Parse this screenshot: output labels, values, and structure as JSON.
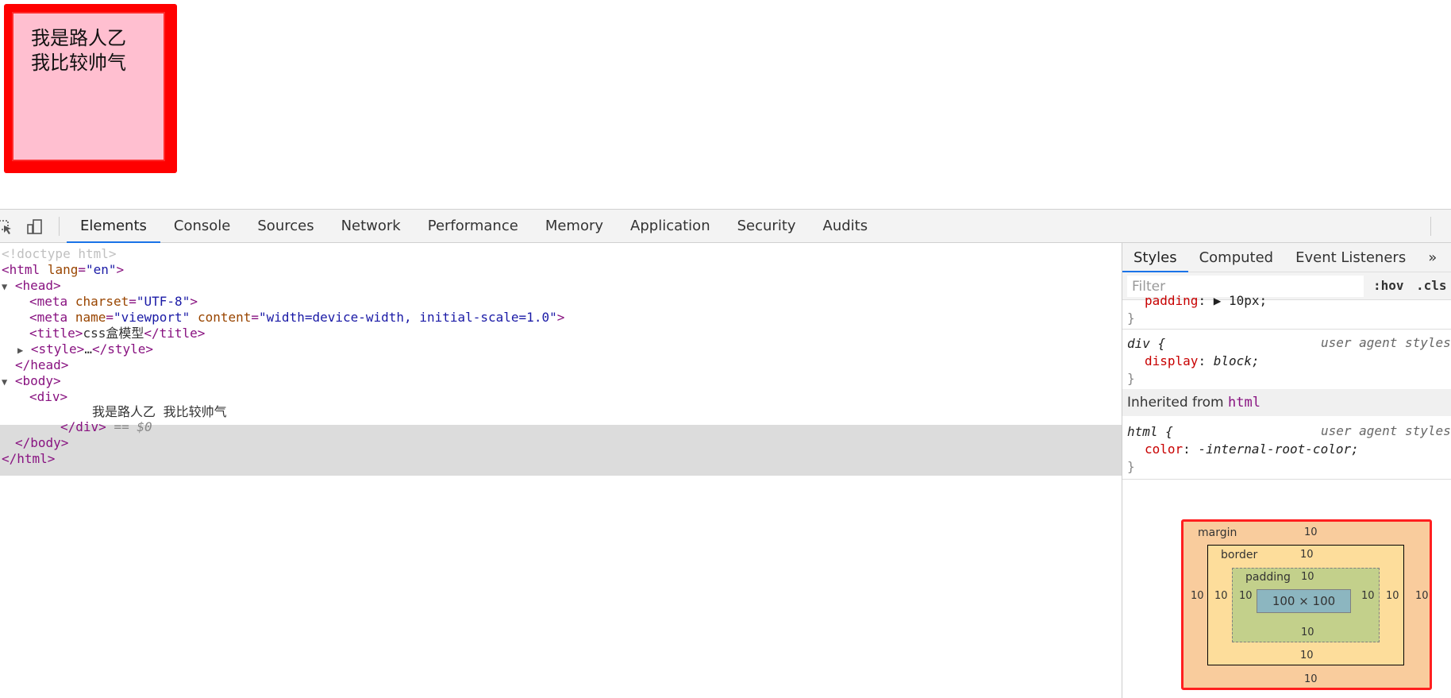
{
  "preview": {
    "line1": "我是路人乙",
    "line2": "我比较帅气"
  },
  "toolbar": {
    "inspect_icon": "inspect-arrow-icon",
    "device_icon": "device-toolbar-icon",
    "tabs": [
      "Elements",
      "Console",
      "Sources",
      "Network",
      "Performance",
      "Memory",
      "Application",
      "Security",
      "Audits"
    ],
    "active_tab": "Elements"
  },
  "dom": {
    "doctype": "<!doctype html>",
    "html_open_tag": "<html",
    "html_attr": "lang",
    "html_attr_val": "\"en\"",
    "head_open": "<head>",
    "meta1_tag": "<meta",
    "meta1_attr": "charset",
    "meta1_val": "\"UTF-8\"",
    "meta2_tag": "<meta",
    "meta2_attr1": "name",
    "meta2_val1": "\"viewport\"",
    "meta2_attr2": "content",
    "meta2_val2": "\"width=device-width, initial-scale=1.0\"",
    "title_open": "<title>",
    "title_text": "css盒模型",
    "title_close": "</title>",
    "style_open": "<style>",
    "style_ellipsis": "…",
    "style_close": "</style>",
    "head_close": "</head>",
    "body_open": "<body>",
    "div_open": "<div>",
    "div_text": "我是路人乙 我比较帅气",
    "div_close": "</div>",
    "div_eq": "== $0",
    "body_close": "</body>",
    "html_close": "</html>"
  },
  "sidebar": {
    "tabs": [
      "Styles",
      "Computed",
      "Event Listeners"
    ],
    "more_label": "»",
    "filter_placeholder": "Filter",
    "hov": ":hov",
    "cls": ".cls",
    "rule0_prop": "padding",
    "rule0_val": "▶ 10px;",
    "rule1_selector": "div {",
    "rule1_source": "user agent stylesheet",
    "rule1_prop": "display",
    "rule1_val": "block;",
    "brace_close": "}",
    "inherited_label": "Inherited from",
    "inherited_tag": "html",
    "rule2_selector": "html {",
    "rule2_source": "user agent stylesheet",
    "rule2_prop": "color",
    "rule2_val": "-internal-root-color;"
  },
  "boxmodel": {
    "margin_label": "margin",
    "border_label": "border",
    "padding_label": "padding",
    "margin_top": "10",
    "margin_bottom": "10",
    "margin_left": "10",
    "margin_right": "10",
    "border_top": "10",
    "border_bottom": "10",
    "border_left": "10",
    "border_right": "10",
    "padding_top": "10",
    "padding_bottom": "10",
    "padding_left": "10",
    "padding_right": "10",
    "content": "100 × 100"
  },
  "colors": {
    "demo_background": "#ffbfd0",
    "demo_border": "#ff0000",
    "active_tab_accent": "#1a73e8"
  }
}
